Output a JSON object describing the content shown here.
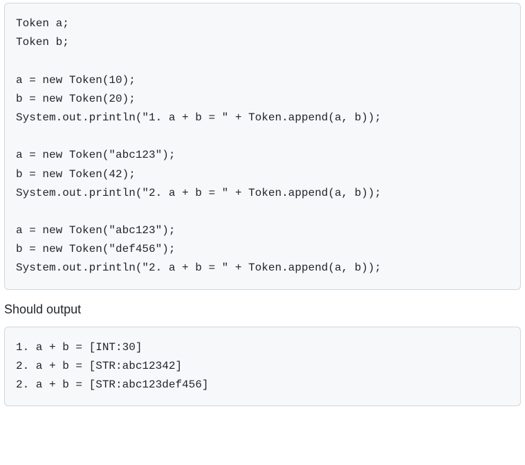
{
  "code1": "Token a;\nToken b;\n\na = new Token(10);\nb = new Token(20);\nSystem.out.println(\"1. a + b = \" + Token.append(a, b));\n\na = new Token(\"abc123\");\nb = new Token(42);\nSystem.out.println(\"2. a + b = \" + Token.append(a, b));\n\na = new Token(\"abc123\");\nb = new Token(\"def456\");\nSystem.out.println(\"2. a + b = \" + Token.append(a, b));",
  "label": "Should output",
  "code2": "1. a + b = [INT:30]\n2. a + b = [STR:abc12342]\n2. a + b = [STR:abc123def456]"
}
